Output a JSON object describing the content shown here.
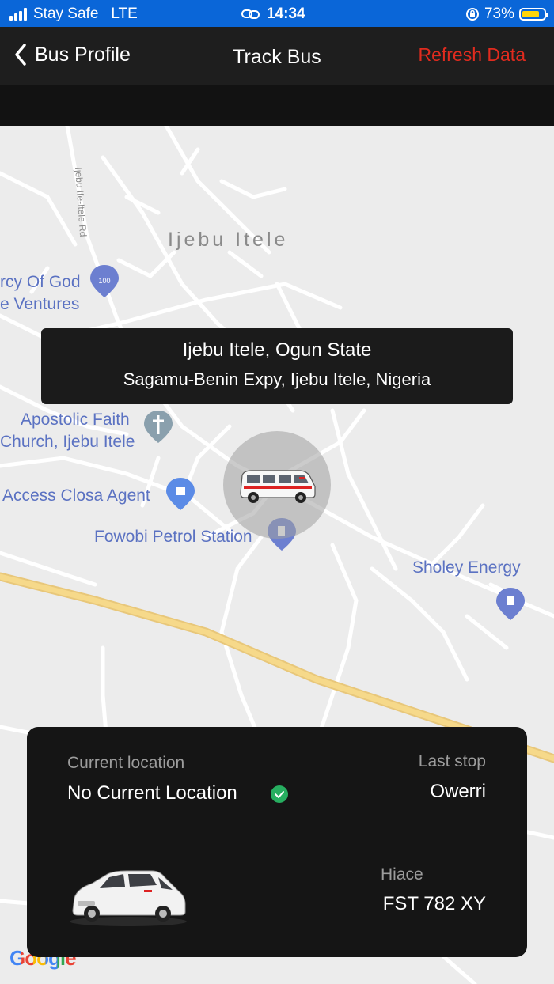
{
  "status_bar": {
    "carrier": "Stay Safe",
    "network": "LTE",
    "time": "14:34",
    "battery": "73%"
  },
  "nav": {
    "back_label": "Bus Profile",
    "title": "Track Bus",
    "action": "Refresh Data"
  },
  "map": {
    "area_name": "Ijebu Itele",
    "road_name": "Ijebu Ife-Itele Rd",
    "places": {
      "mercy_line1": "rcy Of God",
      "mercy_line2": "e Ventures",
      "apostolic_line1": "Apostolic Faith",
      "apostolic_line2": "Church, Ijebu Itele",
      "access": "Access Closa Agent",
      "fowobi": "Fowobi Petrol Station",
      "sholey": "Sholey Energy"
    },
    "pin_badge": "100",
    "attribution": "Google"
  },
  "tooltip": {
    "title": "Ijebu Itele, Ogun State",
    "address": "Sagamu-Benin Expy, Ijebu Itele, Nigeria"
  },
  "card": {
    "current_location_label": "Current location",
    "current_location_value": "No Current Location",
    "last_stop_label": "Last stop",
    "last_stop_value": "Owerri",
    "vehicle_model": "Hiace",
    "plate": "FST 782 XY"
  },
  "colors": {
    "status_bar": "#0a66d8",
    "accent_red": "#e12b1e",
    "map_label": "#5b72c2",
    "highway": "#f6d98a"
  }
}
